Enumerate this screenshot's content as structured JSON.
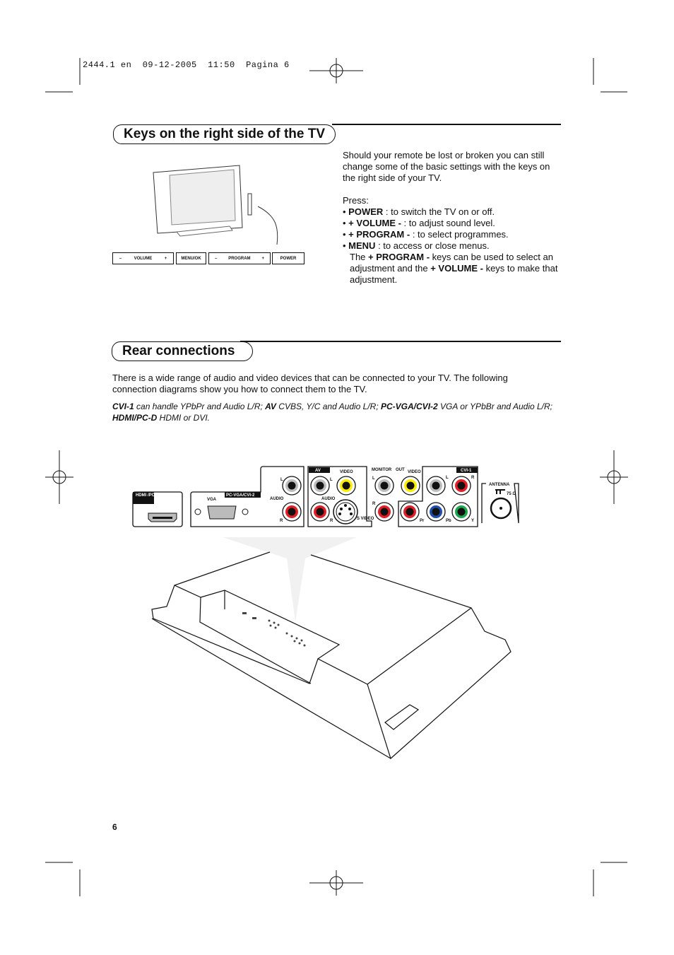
{
  "header": {
    "slug": "2444.1 en",
    "date": "09-12-2005",
    "time": "11:50",
    "page_label": "Pagina 6"
  },
  "keys_section": {
    "title": "Keys on the right side of the TV",
    "intro": "Should your remote be lost or broken you can still change some of the basic settings with the keys on the right side of your TV.",
    "press": "Press:",
    "items": [
      {
        "key": "POWER",
        "text": " : to switch the TV on or off."
      },
      {
        "key": "+ VOLUME -",
        "text": " : to adjust sound level."
      },
      {
        "key": "+ PROGRAM -",
        "text": " : to select programmes."
      },
      {
        "key": "MENU",
        "text": " : to access or close menus."
      }
    ],
    "note_pre": "The ",
    "note_key1": "+ PROGRAM -",
    "note_mid": " keys can be used to select an adjustment and the ",
    "note_key2": "+ VOLUME -",
    "note_post": " keys to make that adjustment.",
    "key_buttons": {
      "minus": "–",
      "plus": "+",
      "volume": "VOLUME",
      "menu": "MENU/OK",
      "program": "PROGRAM",
      "power": "POWER"
    }
  },
  "rear_section": {
    "title": "Rear connections",
    "intro": "There is a wide range of audio and video devices that can be connected to your TV. The following connection diagrams show you how to connect them to the TV.",
    "legend": [
      {
        "key": "CVI-1",
        "text": " can handle YPbPr and Audio L/R;  "
      },
      {
        "key": "AV",
        "text": " CVBS, Y/C and Audio L/R;  "
      },
      {
        "key": "PC-VGA/CVI-2",
        "text": " VGA or YPbBr and Audio L/R;"
      },
      {
        "key": "HDMI/PC-D",
        "text": " HDMI or DVI."
      }
    ],
    "panel": {
      "hdmi": "HDMI /PC-D",
      "pcvga": "PC-VGA/CVI-2",
      "vga": "VGA",
      "audio": "AUDIO",
      "l": "L",
      "r": "R",
      "av": "AV",
      "video": "VIDEO",
      "svideo": "S VIDEO",
      "monitor": "MONITOR",
      "out": "OUT",
      "cvi1": "CVI-1",
      "pr": "Pr",
      "pb": "Pb",
      "y": "Y",
      "antenna": "ANTENNA",
      "ohm": "75 Ω"
    },
    "colors": {
      "red": "#e31e24",
      "yellow": "#ffed00",
      "blue": "#1f4fa8",
      "green": "#1aa84a",
      "grey": "#bdbdbd"
    }
  },
  "footer": {
    "page_number": "6"
  }
}
